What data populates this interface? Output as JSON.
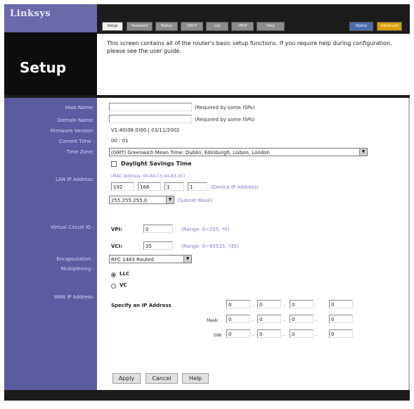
{
  "header": {
    "logo": "Linksys",
    "page_title": "Setup",
    "description": "This screen contains all of the router's basic setup functions. If you require help during configuration, please see the user guide."
  },
  "tabs": [
    "Setup",
    "Password",
    "Status",
    "DHCP",
    "Log",
    "UPnP",
    "Help",
    "Status",
    "Advanced"
  ],
  "labels": {
    "host_name": "Host Name:",
    "domain_name": "Domain Name:",
    "firmware_version": "Firmware Version:",
    "current_time": "Current Time :",
    "time_zone": "Time Zone:",
    "lan_ip": "LAN IP Address:",
    "virtual_circuit": "Virtual Circuit ID :",
    "encapsulation": "Encapsulation :",
    "multiplexing": "Multiplexing :",
    "wan_ip": "WAN IP Address:"
  },
  "fields": {
    "host_name": "",
    "domain_name": "",
    "required_note": "(Required by some ISPs)",
    "firmware_version": "V1.40(08.0)00 | 03/11/2002",
    "current_time": "00 : 01",
    "time_zone": "(GMT) Greenwich Mean Time: Dublin, Edinburgh, Lisbon, London",
    "daylight_savings": "Daylight Savings Time",
    "mac_address": "(MAC Address: 00-A0-C5-44-83-3C)",
    "lan_ip": [
      "192",
      "168",
      "1",
      "1"
    ],
    "device_ip_note": "(Device IP Address)",
    "subnet_mask": "255.255.255.0",
    "subnet_note": "(Subnet Mask)",
    "vpi_label": "VPI:",
    "vpi": "0",
    "vpi_range": "(Range: 0~255, *0)",
    "vci_label": "VCI:",
    "vci": "35",
    "vci_range": "(Range: 0~65535, *35)",
    "encapsulation": "RFC 1483 Routed",
    "mux_llc": "LLC",
    "mux_vc": "VC",
    "specify_ip": "Specify an IP Address",
    "wan_ip": [
      "0",
      "0",
      "0",
      "0"
    ],
    "wan_mask_label": "Mask:",
    "wan_mask": [
      "0",
      "0",
      "0",
      "0"
    ],
    "wan_gw_label": "GW:",
    "wan_gw": [
      "0",
      "0",
      "0",
      "0"
    ]
  },
  "buttons": {
    "apply": "Apply",
    "cancel": "Cancel",
    "help": "Help"
  }
}
